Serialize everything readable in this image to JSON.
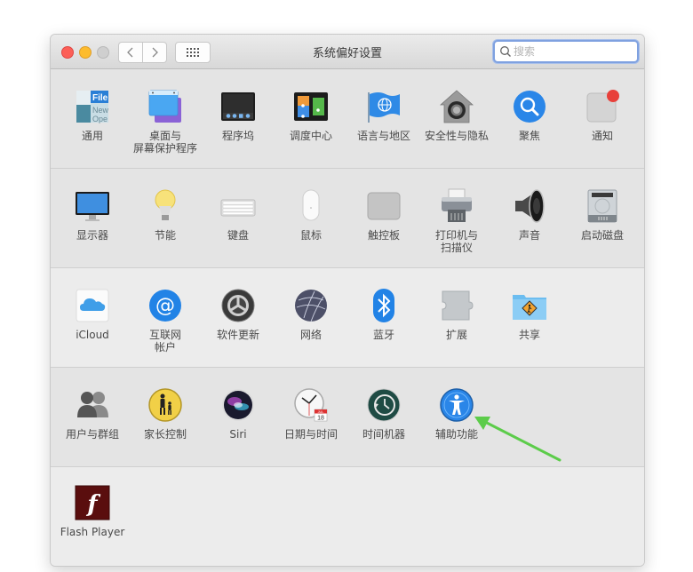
{
  "window": {
    "title": "系统偏好设置",
    "search_placeholder": "搜索",
    "search_value": ""
  },
  "sections": [
    {
      "panes": [
        {
          "id": "general",
          "label": "通用",
          "icon": "general-icon"
        },
        {
          "id": "desktop",
          "label": "桌面与\n屏幕保护程序",
          "icon": "desktop-screensaver-icon"
        },
        {
          "id": "dock",
          "label": "程序坞",
          "icon": "dock-icon"
        },
        {
          "id": "mission-control",
          "label": "调度中心",
          "icon": "mission-control-icon"
        },
        {
          "id": "language",
          "label": "语言与地区",
          "icon": "language-region-icon"
        },
        {
          "id": "security",
          "label": "安全性与隐私",
          "icon": "security-privacy-icon"
        },
        {
          "id": "spotlight",
          "label": "聚焦",
          "icon": "spotlight-icon"
        },
        {
          "id": "notifications",
          "label": "通知",
          "icon": "notifications-icon"
        }
      ]
    },
    {
      "panes": [
        {
          "id": "displays",
          "label": "显示器",
          "icon": "displays-icon"
        },
        {
          "id": "energy",
          "label": "节能",
          "icon": "energy-saver-icon"
        },
        {
          "id": "keyboard",
          "label": "键盘",
          "icon": "keyboard-icon"
        },
        {
          "id": "mouse",
          "label": "鼠标",
          "icon": "mouse-icon"
        },
        {
          "id": "trackpad",
          "label": "触控板",
          "icon": "trackpad-icon"
        },
        {
          "id": "printers",
          "label": "打印机与\n扫描仪",
          "icon": "printer-scanner-icon"
        },
        {
          "id": "sound",
          "label": "声音",
          "icon": "sound-icon"
        },
        {
          "id": "startup-disk",
          "label": "启动磁盘",
          "icon": "startup-disk-icon"
        }
      ]
    },
    {
      "panes": [
        {
          "id": "icloud",
          "label": "iCloud",
          "icon": "icloud-icon"
        },
        {
          "id": "internet-accounts",
          "label": "互联网\n帐户",
          "icon": "internet-accounts-icon"
        },
        {
          "id": "software-update",
          "label": "软件更新",
          "icon": "software-update-icon"
        },
        {
          "id": "network",
          "label": "网络",
          "icon": "network-icon"
        },
        {
          "id": "bluetooth",
          "label": "蓝牙",
          "icon": "bluetooth-icon"
        },
        {
          "id": "extensions",
          "label": "扩展",
          "icon": "extensions-icon"
        },
        {
          "id": "sharing",
          "label": "共享",
          "icon": "sharing-icon"
        }
      ]
    },
    {
      "panes": [
        {
          "id": "users-groups",
          "label": "用户与群组",
          "icon": "users-groups-icon"
        },
        {
          "id": "parental-controls",
          "label": "家长控制",
          "icon": "parental-controls-icon"
        },
        {
          "id": "siri",
          "label": "Siri",
          "icon": "siri-icon"
        },
        {
          "id": "date-time",
          "label": "日期与时间",
          "icon": "date-time-icon"
        },
        {
          "id": "time-machine",
          "label": "时间机器",
          "icon": "time-machine-icon"
        },
        {
          "id": "accessibility",
          "label": "辅助功能",
          "icon": "accessibility-icon"
        }
      ]
    },
    {
      "panes": [
        {
          "id": "flash-player",
          "label": "Flash Player",
          "icon": "flash-player-icon"
        }
      ]
    }
  ],
  "icon_text": {
    "general_file": "File",
    "general_new": "New",
    "general_open": "Ope",
    "calendar_month": "JUL",
    "calendar_day": "18",
    "flash_glyph": "f"
  },
  "annotation": {
    "arrow_color": "#5ccc4a",
    "target": "accessibility"
  }
}
